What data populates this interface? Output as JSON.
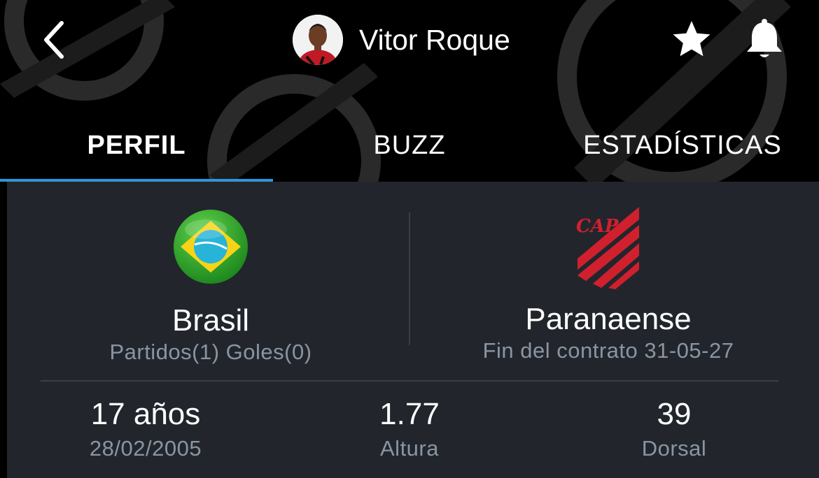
{
  "header": {
    "player_name": "Vitor Roque",
    "icons": {
      "back": "chevron-left-icon",
      "favorite": "star-icon",
      "notifications": "bell-icon"
    }
  },
  "tabs": [
    {
      "label": "PERFIL",
      "active": true
    },
    {
      "label": "BUZZ",
      "active": false
    },
    {
      "label": "ESTADÍSTICAS",
      "active": false
    }
  ],
  "national_team": {
    "name": "Brasil",
    "detail": "Partidos(1) Goles(0)"
  },
  "club": {
    "name": "Paranaense",
    "detail": "Fin del contrato 31-05-27",
    "crest_text": "CAP"
  },
  "stats": [
    {
      "value": "17 años",
      "label": "28/02/2005"
    },
    {
      "value": "1.77",
      "label": "Altura"
    },
    {
      "value": "39",
      "label": "Dorsal"
    }
  ],
  "colors": {
    "accent": "#2f95d6",
    "panel": "#22262c",
    "muted_text": "#8a95a3",
    "club_red": "#d0202e"
  }
}
